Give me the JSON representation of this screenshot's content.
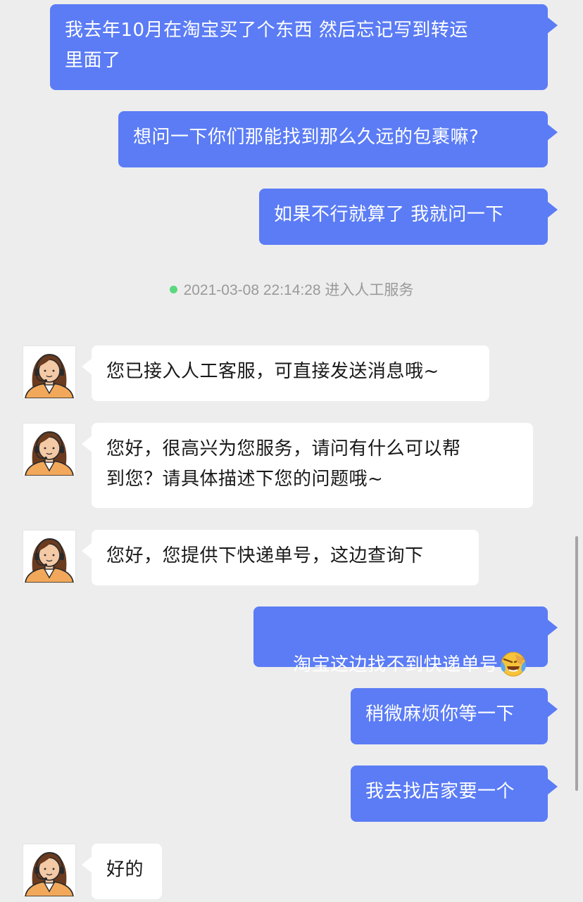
{
  "colors": {
    "background": "#ededed",
    "outgoing_bubble": "#5b7cf5",
    "incoming_bubble": "#ffffff",
    "status_dot": "#5ad87c",
    "system_text": "#9a9a9a"
  },
  "messages": {
    "m1": "我去年10月在淘宝买了个东西 然后忘记写到转运\n里面了",
    "m2": "想问一下你们那能找到那么久远的包裹嘛?",
    "m3": "如果不行就算了 我就问一下",
    "m4": "您已接入人工客服，可直接发送消息哦~",
    "m5": "您好，很高兴为您服务，请问有什么可以帮\n到您？请具体描述下您的问题哦~",
    "m6": "您好，您提供下快递单号，这边查询下",
    "m7": "淘宝这边找不到快递单号",
    "m8": "稍微麻烦你等一下",
    "m9": "我去找店家要一个",
    "m10": "好的"
  },
  "system": {
    "text": "2021-03-08 22:14:28 进入人工服务"
  },
  "icons": {
    "agent_avatar": "customer-service-agent-avatar-icon",
    "emoji": "face-with-tears-of-joy-emoji-icon",
    "status": "online-status-dot-icon"
  }
}
